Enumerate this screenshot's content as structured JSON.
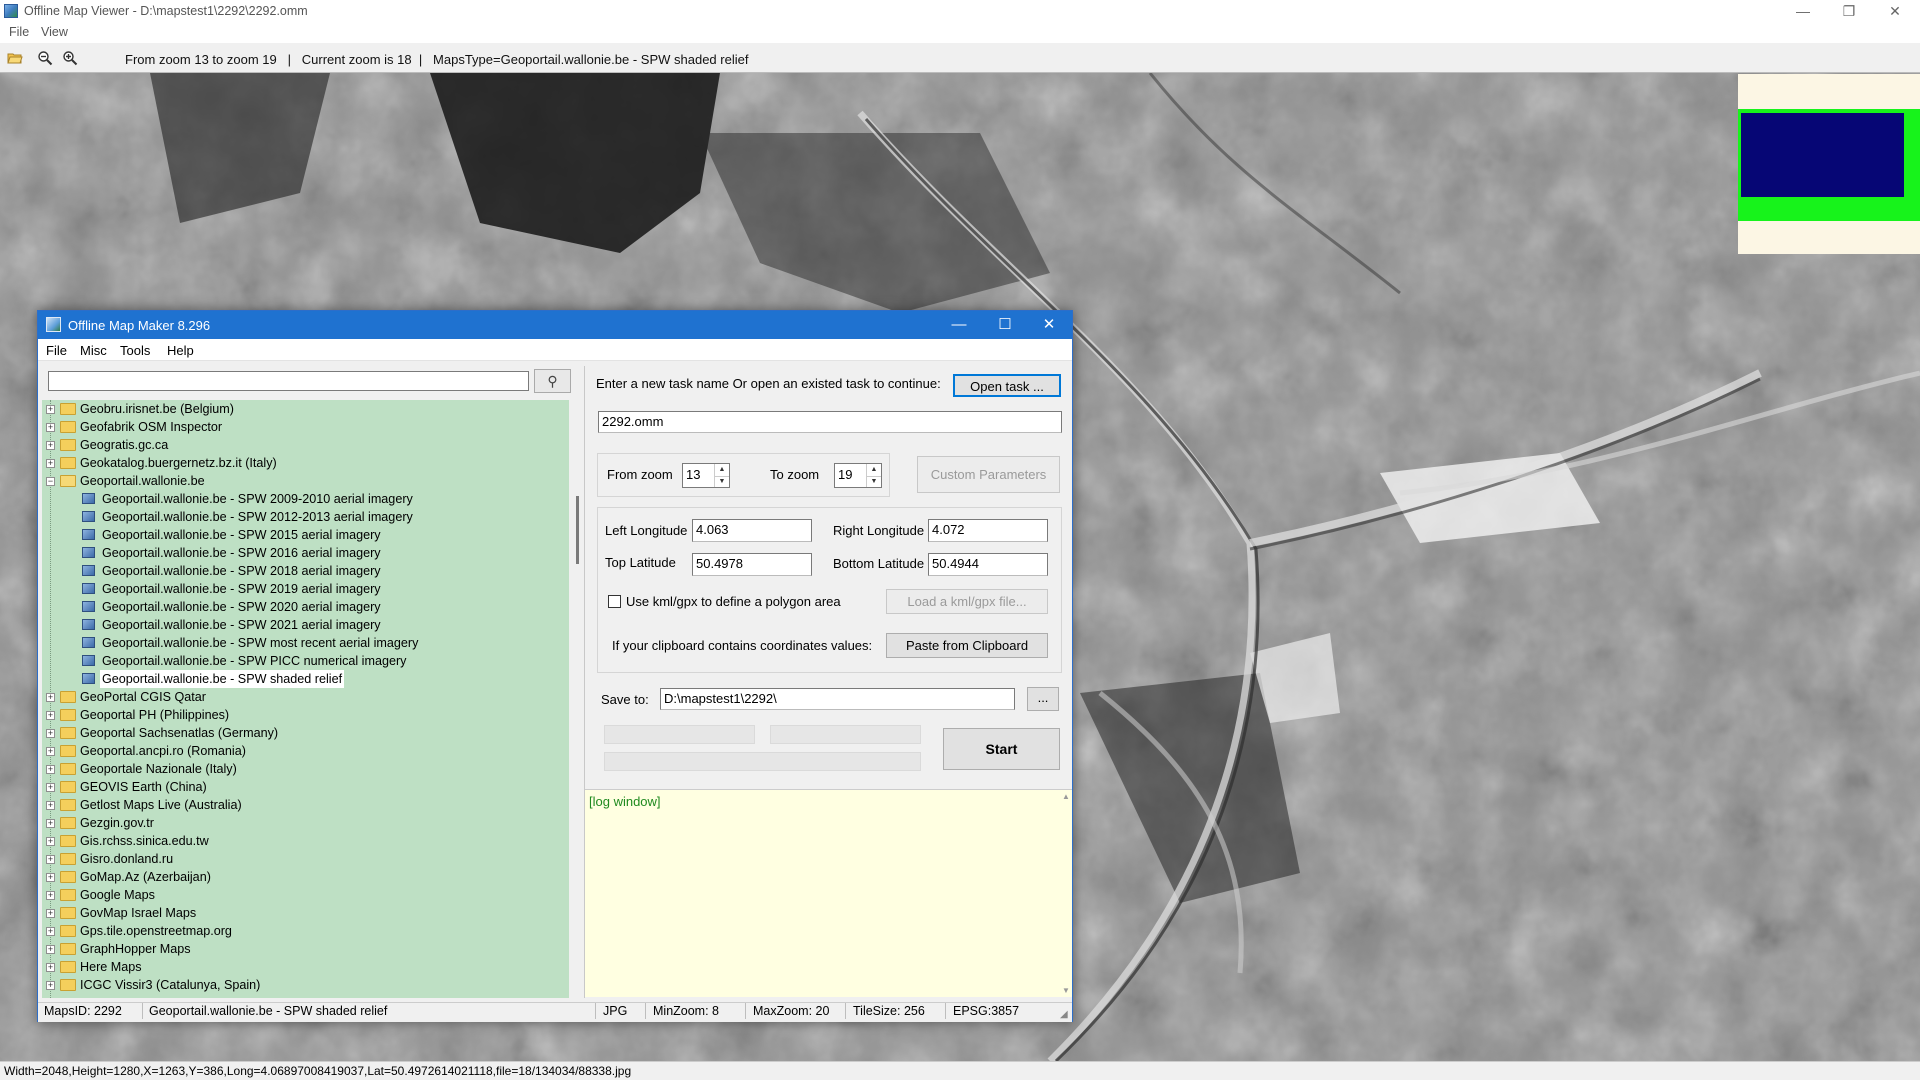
{
  "viewer": {
    "title": "Offline Map Viewer - D:\\mapstest1\\2292\\2292.omm",
    "menu": [
      "File",
      "View"
    ],
    "toolbar_status": "From zoom 13 to zoom 19   |   Current zoom is 18  |   MapsType=Geoportail.wallonie.be - SPW shaded relief",
    "statusbar": "Width=2048,Height=1280,X=1263,Y=386,Long=4.06897008419037,Lat=50.4972614021118,file=18/134034/88338.jpg",
    "minimap_colors": {
      "background": "#fcf6e4",
      "frame": "#17f31b",
      "viewport": "#060675"
    }
  },
  "dialog": {
    "title": "Offline Map Maker 8.296",
    "menu": [
      "File",
      "Misc",
      "Tools",
      "Help"
    ],
    "search": {
      "value": ""
    },
    "tree": [
      {
        "label": "Geobru.irisnet.be (Belgium)",
        "type": "folder"
      },
      {
        "label": "Geofabrik OSM Inspector",
        "type": "folder"
      },
      {
        "label": "Geogratis.gc.ca",
        "type": "folder"
      },
      {
        "label": "Geokatalog.buergernetz.bz.it (Italy)",
        "type": "folder"
      },
      {
        "label": "Geoportail.wallonie.be",
        "type": "folder-open"
      },
      {
        "label": "Geoportail.wallonie.be - SPW 2009-2010 aerial imagery",
        "type": "map"
      },
      {
        "label": "Geoportail.wallonie.be - SPW 2012-2013 aerial imagery",
        "type": "map"
      },
      {
        "label": "Geoportail.wallonie.be - SPW 2015 aerial imagery",
        "type": "map"
      },
      {
        "label": "Geoportail.wallonie.be - SPW 2016 aerial imagery",
        "type": "map"
      },
      {
        "label": "Geoportail.wallonie.be - SPW 2018 aerial imagery",
        "type": "map"
      },
      {
        "label": "Geoportail.wallonie.be - SPW 2019 aerial imagery",
        "type": "map"
      },
      {
        "label": "Geoportail.wallonie.be - SPW 2020 aerial imagery",
        "type": "map"
      },
      {
        "label": "Geoportail.wallonie.be - SPW 2021 aerial imagery",
        "type": "map"
      },
      {
        "label": "Geoportail.wallonie.be - SPW most recent aerial imagery",
        "type": "map"
      },
      {
        "label": "Geoportail.wallonie.be - SPW PICC numerical imagery",
        "type": "map"
      },
      {
        "label": "Geoportail.wallonie.be - SPW shaded relief",
        "type": "map",
        "selected": true
      },
      {
        "label": "GeoPortal CGIS Qatar",
        "type": "folder"
      },
      {
        "label": "Geoportal PH (Philippines)",
        "type": "folder"
      },
      {
        "label": "Geoportal Sachsenatlas (Germany)",
        "type": "folder"
      },
      {
        "label": "Geoportal.ancpi.ro (Romania)",
        "type": "folder"
      },
      {
        "label": "Geoportale Nazionale (Italy)",
        "type": "folder"
      },
      {
        "label": "GEOVIS Earth (China)",
        "type": "folder"
      },
      {
        "label": "Getlost Maps Live (Australia)",
        "type": "folder"
      },
      {
        "label": "Gezgin.gov.tr",
        "type": "folder"
      },
      {
        "label": "Gis.rchss.sinica.edu.tw",
        "type": "folder"
      },
      {
        "label": "Gisro.donland.ru",
        "type": "folder"
      },
      {
        "label": "GoMap.Az (Azerbaijan)",
        "type": "folder"
      },
      {
        "label": "Google Maps",
        "type": "folder"
      },
      {
        "label": "GovMap Israel Maps",
        "type": "folder"
      },
      {
        "label": "Gps.tile.openstreetmap.org",
        "type": "folder"
      },
      {
        "label": "GraphHopper Maps",
        "type": "folder"
      },
      {
        "label": "Here Maps",
        "type": "folder"
      },
      {
        "label": "ICGC Vissir3 (Catalunya, Spain)",
        "type": "folder"
      }
    ],
    "task": {
      "prompt": "Enter a new task name Or open an existed task to continue:",
      "open_button": "Open task ...",
      "name": "2292.omm"
    },
    "zoom": {
      "from_label": "From zoom",
      "from_value": "13",
      "to_label": "To zoom",
      "to_value": "19",
      "custom_button": "Custom Parameters"
    },
    "coords": {
      "left_lon_label": "Left Longitude",
      "left_lon": "4.063",
      "right_lon_label": "Right Longitude",
      "right_lon": "4.072",
      "top_lat_label": "Top Latitude",
      "top_lat": "50.4978",
      "bottom_lat_label": "Bottom Latitude",
      "bottom_lat": "50.4944",
      "kml_label": "Use kml/gpx to define a polygon area",
      "kml_button": "Load a kml/gpx file...",
      "clipboard_label": "If your clipboard contains coordinates values:",
      "clipboard_button": "Paste from Clipboard"
    },
    "save": {
      "label": "Save to:",
      "path": "D:\\mapstest1\\2292\\",
      "browse": "..."
    },
    "start_button": "Start",
    "log_text": "[log window]",
    "status": {
      "maps_id": "MapsID: 2292",
      "maps_name": "Geoportail.wallonie.be - SPW shaded relief",
      "format": "JPG",
      "min_zoom": "MinZoom: 8",
      "max_zoom": "MaxZoom: 20",
      "tile_size": "TileSize: 256",
      "epsg": "EPSG:3857"
    }
  }
}
